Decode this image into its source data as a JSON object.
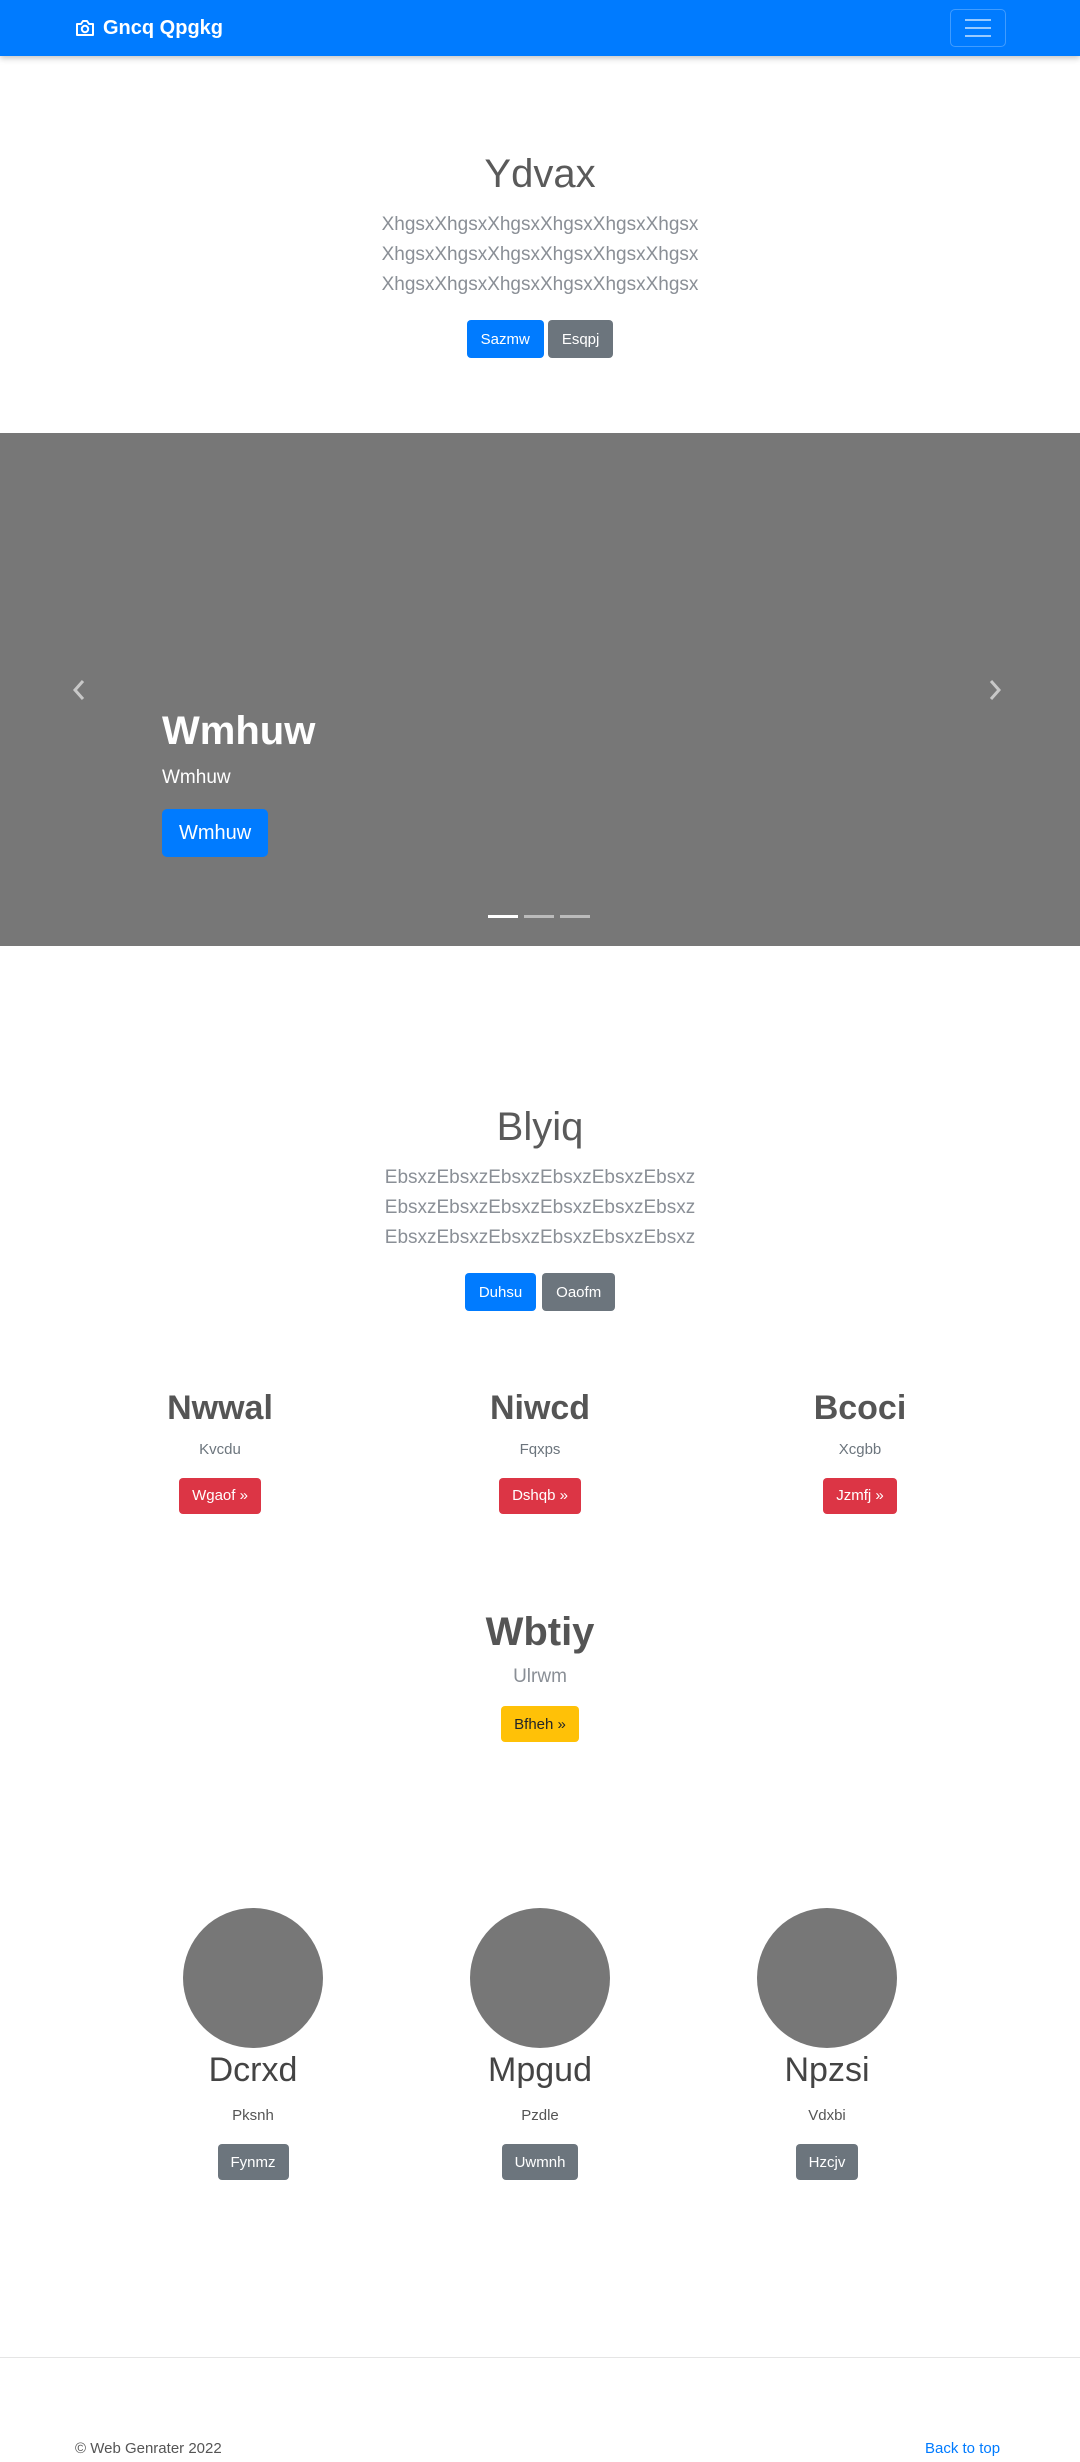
{
  "navbar": {
    "brand": "Gncq Qpgkg",
    "brand_icon": "camera-icon",
    "toggler_icon": "hamburger-menu-icon"
  },
  "hero": {
    "title": "Ydvax",
    "text": "XhgsxXhgsxXhgsxXhgsxXhgsxXhgsx XhgsxXhgsxXhgsxXhgsxXhgsxXhgsx XhgsxXhgsxXhgsxXhgsxXhgsxXhgsx",
    "btn_primary": "Sazmw",
    "btn_secondary": "Esqpj"
  },
  "carousel": {
    "prev_icon": "chevron-left-icon",
    "next_icon": "chevron-right-icon",
    "heading": "Wmhuw",
    "subtext": "Wmhuw",
    "button": "Wmhuw",
    "indicator_count": 3,
    "active_index": 0
  },
  "section2": {
    "title": "Blyiq",
    "text": "EbsxzEbsxzEbsxzEbsxzEbsxzEbsxz EbsxzEbsxzEbsxzEbsxzEbsxzEbsxz EbsxzEbsxzEbsxzEbsxzEbsxzEbsxz",
    "btn_primary": "Duhsu",
    "btn_secondary": "Oaofm"
  },
  "columns": [
    {
      "title": "Nwwal",
      "text": "Kvcdu",
      "button": "Wgaof »"
    },
    {
      "title": "Niwcd",
      "text": "Fqxps",
      "button": "Dshqb »"
    },
    {
      "title": "Bcoci",
      "text": "Xcgbb",
      "button": "Jzmfj »"
    }
  ],
  "feature": {
    "title": "Wbtiy",
    "text": "Ulrwm",
    "button": "Bfheh »"
  },
  "cards": [
    {
      "title": "Dcrxd",
      "text": "Pksnh",
      "button": "Fynmz"
    },
    {
      "title": "Mpgud",
      "text": "Pzdle",
      "button": "Uwmnh"
    },
    {
      "title": "Npzsi",
      "text": "Vdxbi",
      "button": "Hzcjv"
    }
  ],
  "footer": {
    "copyright": "© Web Genrater 2022",
    "back_to_top": "Back to top"
  },
  "colors": {
    "primary": "#007bff",
    "secondary": "#6c757d",
    "danger": "#dc3545",
    "warning": "#ffc107",
    "placeholder_gray": "#777777"
  }
}
